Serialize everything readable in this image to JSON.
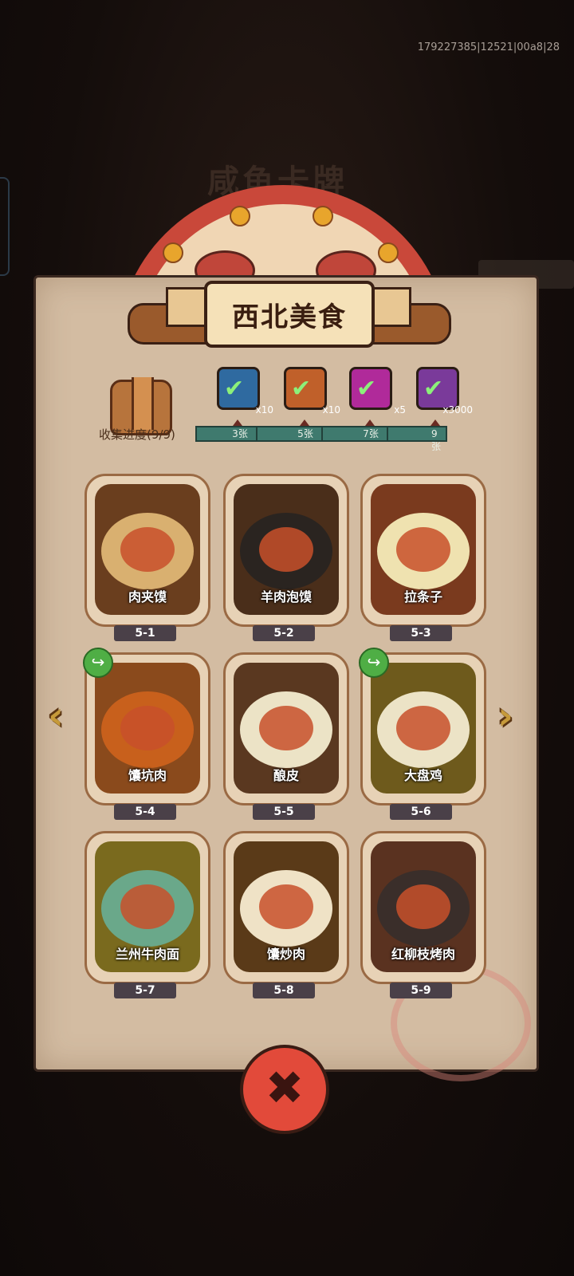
{
  "build_id": "179227385|12521|00a8|28",
  "background": {
    "ghost_title": "咸鱼卡牌"
  },
  "banner": {
    "title": "西北美食"
  },
  "progress": {
    "label": "收集进度(9/9)",
    "rewards": [
      {
        "icon": "blue-ticket-icon",
        "qty": "x10",
        "color": "#2f6aa0",
        "claimed": true
      },
      {
        "icon": "orange-scroll-icon",
        "qty": "x10",
        "color": "#c0602a",
        "claimed": true
      },
      {
        "icon": "purple-orb-icon",
        "qty": "x5",
        "color": "#b02a9a",
        "claimed": true
      },
      {
        "icon": "purple-gem-icon",
        "qty": "x3000",
        "color": "#7a3a9a",
        "claimed": true
      }
    ],
    "milestones": [
      "3张",
      "5张",
      "7张",
      "9张"
    ]
  },
  "cards": [
    {
      "name": "肉夹馍",
      "id": "5-1",
      "share": false,
      "art": "#6a3e1e",
      "plate": "#d9b070"
    },
    {
      "name": "羊肉泡馍",
      "id": "5-2",
      "share": false,
      "art": "#4a2e1a",
      "plate": "#2a2420"
    },
    {
      "name": "拉条子",
      "id": "5-3",
      "share": false,
      "art": "#7a3a1e",
      "plate": "#efe2b0"
    },
    {
      "name": "馕坑肉",
      "id": "5-4",
      "share": true,
      "art": "#8a4a1c",
      "plate": "#c8601c"
    },
    {
      "name": "酿皮",
      "id": "5-5",
      "share": false,
      "art": "#5a3820",
      "plate": "#ece3c6"
    },
    {
      "name": "大盘鸡",
      "id": "5-6",
      "share": true,
      "art": "#6e5a1c",
      "plate": "#ece3c6"
    },
    {
      "name": "兰州牛肉面",
      "id": "5-7",
      "share": false,
      "art": "#7a6a1e",
      "plate": "#6aa88a"
    },
    {
      "name": "馕炒肉",
      "id": "5-8",
      "share": false,
      "art": "#5a3a18",
      "plate": "#efe2c6"
    },
    {
      "name": "红柳枝烤肉",
      "id": "5-9",
      "share": false,
      "art": "#5a3220",
      "plate": "#3a2e2a"
    }
  ],
  "nav": {
    "prev": "‹",
    "next": "›"
  },
  "close": {
    "symbol": "✖"
  }
}
